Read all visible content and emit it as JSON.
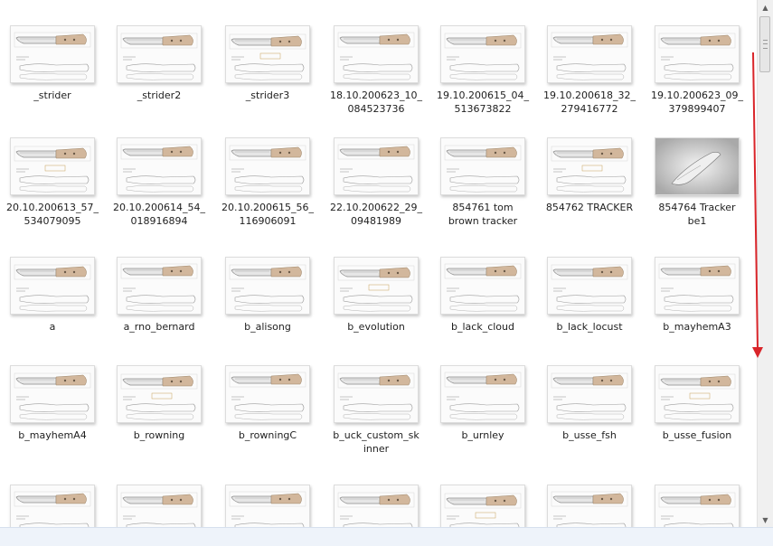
{
  "window": {
    "view": "Large icons"
  },
  "files": [
    {
      "label": "_strider",
      "thumb": "template"
    },
    {
      "label": "_strider2",
      "thumb": "template"
    },
    {
      "label": "_strider3",
      "thumb": "template"
    },
    {
      "label": "18.10.200623_10_\n084523736",
      "thumb": "template"
    },
    {
      "label": "19.10.200615_04_\n513673822",
      "thumb": "template"
    },
    {
      "label": "19.10.200618_32_\n279416772",
      "thumb": "template"
    },
    {
      "label": "19.10.200623_09_\n379899407",
      "thumb": "template"
    },
    {
      "label": "20.10.200613_57_\n534079095",
      "thumb": "template"
    },
    {
      "label": "20.10.200614_54_\n018916894",
      "thumb": "template"
    },
    {
      "label": "20.10.200615_56_\n116906091",
      "thumb": "template"
    },
    {
      "label": "22.10.200622_29_\n09481989",
      "thumb": "template"
    },
    {
      "label": "854761 tom\nbrown tracker",
      "thumb": "template"
    },
    {
      "label": "854762 TRACKER",
      "thumb": "template"
    },
    {
      "label": "854764 Tracker\nbe1",
      "thumb": "photo"
    },
    {
      "label": "a",
      "thumb": "template"
    },
    {
      "label": "a_rno_bernard",
      "thumb": "template"
    },
    {
      "label": "b_alisong",
      "thumb": "template"
    },
    {
      "label": "b_evolution",
      "thumb": "template"
    },
    {
      "label": "b_lack_cloud",
      "thumb": "template"
    },
    {
      "label": "b_lack_locust",
      "thumb": "template"
    },
    {
      "label": "b_mayhemA3",
      "thumb": "template"
    },
    {
      "label": "b_mayhemA4",
      "thumb": "template"
    },
    {
      "label": "b_rowning",
      "thumb": "template"
    },
    {
      "label": "b_rowningC",
      "thumb": "template"
    },
    {
      "label": "b_uck_custom_sk\ninner",
      "thumb": "template"
    },
    {
      "label": "b_urnley",
      "thumb": "template"
    },
    {
      "label": "b_usse_fsh",
      "thumb": "template"
    },
    {
      "label": "b_usse_fusion",
      "thumb": "template"
    },
    {
      "label": "",
      "thumb": "template"
    },
    {
      "label": "",
      "thumb": "template"
    },
    {
      "label": "",
      "thumb": "template"
    },
    {
      "label": "",
      "thumb": "template"
    },
    {
      "label": "",
      "thumb": "template"
    },
    {
      "label": "",
      "thumb": "template"
    },
    {
      "label": "",
      "thumb": "template"
    }
  ],
  "colors": {
    "annotation_arrow": "#d9252a",
    "handle_tan": "#d2b79c",
    "blade_gray": "#8a8a8a"
  },
  "icons": {
    "scroll_up": "▲",
    "scroll_down": "▼"
  }
}
